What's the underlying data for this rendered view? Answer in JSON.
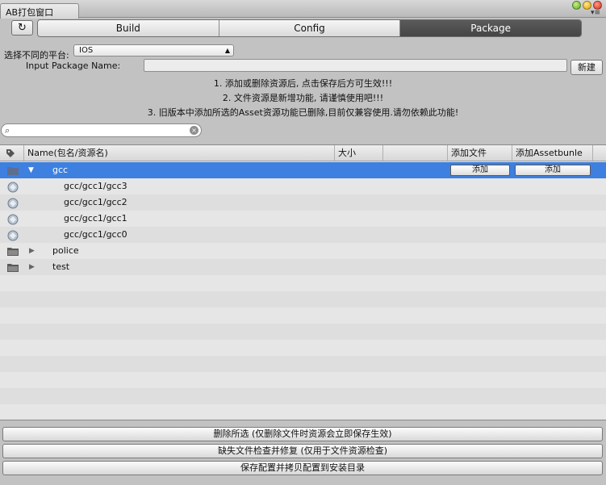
{
  "window": {
    "title": "AB打包窗口"
  },
  "tabs": [
    {
      "label": "Build",
      "active": false
    },
    {
      "label": "Config",
      "active": false
    },
    {
      "label": "Package",
      "active": true
    }
  ],
  "platform": {
    "label": "选择不同的平台:",
    "selected": "IOS"
  },
  "package_name": {
    "label": "Input Package Name:",
    "value": "",
    "new_button": "新建"
  },
  "notes": [
    "1. 添加或删除资源后, 点击保存后方可生效!!!",
    "2. 文件资源是新增功能, 请谨慎使用吧!!!",
    "3. 旧版本中添加所选的Asset资源功能已删除,目前仅兼容使用.请勿依赖此功能!"
  ],
  "search": {
    "value": ""
  },
  "table": {
    "columns": [
      "Name(包名/资源名)",
      "大小",
      "",
      "添加文件",
      "添加Assetbunle"
    ],
    "rows": [
      {
        "name": "gcc",
        "type": "folder",
        "expanded": true,
        "selected": true,
        "add_file": "添加",
        "add_bundle": "添加"
      },
      {
        "name": "gcc/gcc1/gcc3",
        "type": "asset"
      },
      {
        "name": "gcc/gcc1/gcc2",
        "type": "asset"
      },
      {
        "name": "gcc/gcc1/gcc1",
        "type": "asset"
      },
      {
        "name": "gcc/gcc1/gcc0",
        "type": "asset"
      },
      {
        "name": "police",
        "type": "folder",
        "expanded": false
      },
      {
        "name": "test",
        "type": "folder",
        "expanded": false
      }
    ]
  },
  "buttons": {
    "delete_selected": "删除所选 (仅删除文件时资源会立即保存生效)",
    "check_missing": "缺失文件检查并修复 (仅用于文件资源检查)",
    "save_config": "保存配置并拷贝配置到安装目录"
  },
  "colors": {
    "selection": "#3d80df",
    "active_tab": "#4f4f4f"
  }
}
